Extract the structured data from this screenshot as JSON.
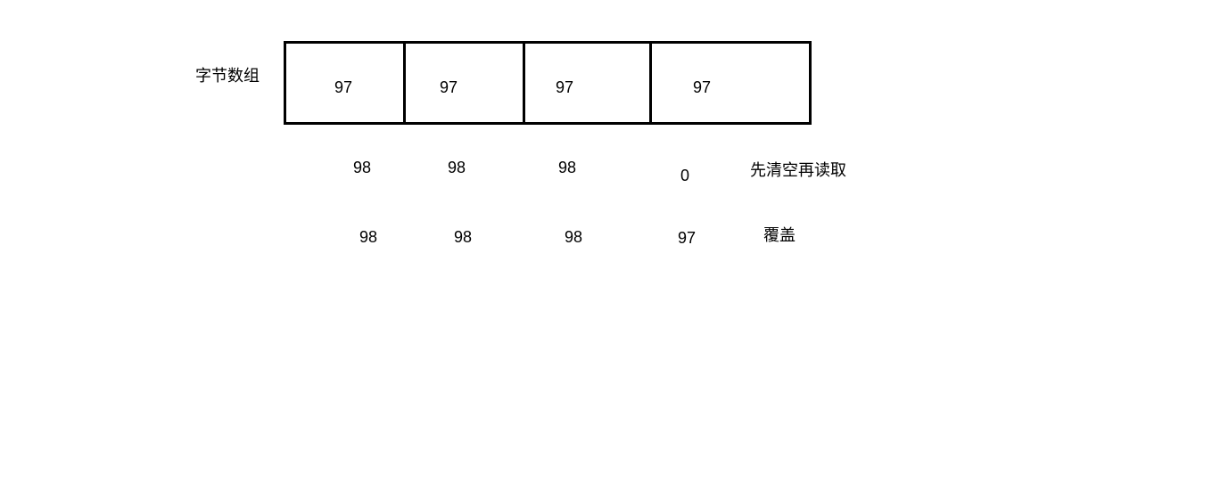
{
  "array_label": "字节数组",
  "cells": [
    "97",
    "97",
    "97",
    "97"
  ],
  "row_clear": {
    "values": [
      "98",
      "98",
      "98",
      "0"
    ],
    "note": "先清空再读取"
  },
  "row_overwrite": {
    "values": [
      "98",
      "98",
      "98",
      "97"
    ],
    "note": "覆盖"
  }
}
